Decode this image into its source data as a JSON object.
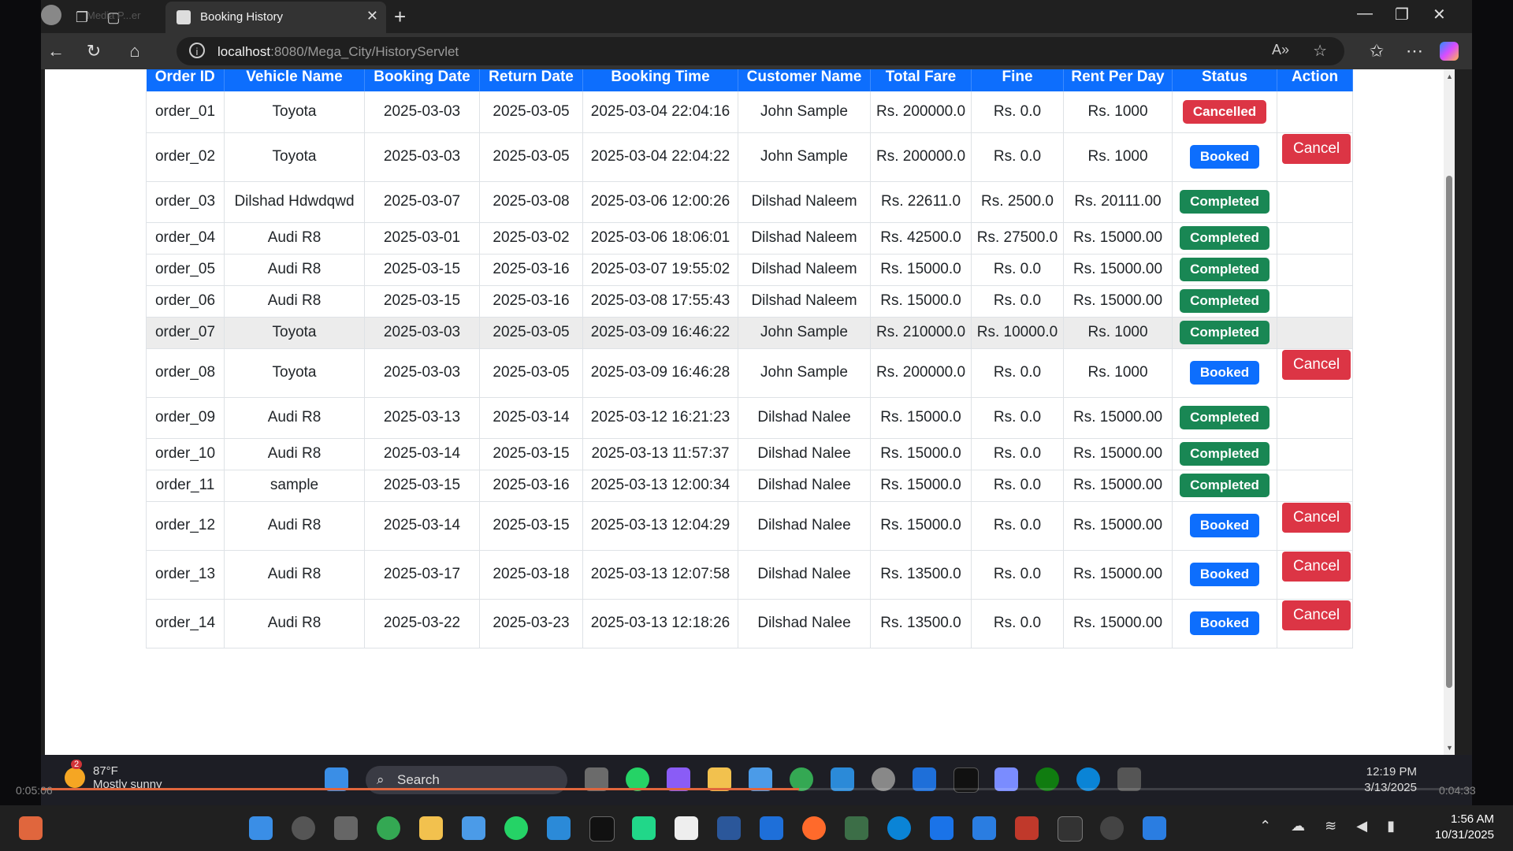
{
  "browser": {
    "tab_title": "Booking History",
    "ghost_tab": "Media P...er",
    "url_host": "localhost",
    "url_rest": ":8080/Mega_City/HistoryServlet"
  },
  "table": {
    "headers": [
      "Order ID",
      "Vehicle Name",
      "Booking Date",
      "Return Date",
      "Booking Time",
      "Customer Name",
      "Total Fare",
      "Fine",
      "Rent Per Day",
      "Status",
      "Action"
    ],
    "rows": [
      {
        "order": "order_01",
        "vehicle": "Toyota",
        "booking_date": "2025-03-03",
        "return_date": "2025-03-05",
        "booking_time": "2025-03-04 22:04:16",
        "customer": "John Sample",
        "fare": "Rs. 200000.0",
        "fine": "Rs. 0.0",
        "rent": "Rs. 1000",
        "status": "Cancelled",
        "action": ""
      },
      {
        "order": "order_02",
        "vehicle": "Toyota",
        "booking_date": "2025-03-03",
        "return_date": "2025-03-05",
        "booking_time": "2025-03-04 22:04:22",
        "customer": "John Sample",
        "fare": "Rs. 200000.0",
        "fine": "Rs. 0.0",
        "rent": "Rs. 1000",
        "status": "Booked",
        "action": "Cancel"
      },
      {
        "order": "order_03",
        "vehicle": "Dilshad Hdwdqwd",
        "booking_date": "2025-03-07",
        "return_date": "2025-03-08",
        "booking_time": "2025-03-06 12:00:26",
        "customer": "Dilshad Naleem",
        "fare": "Rs. 22611.0",
        "fine": "Rs. 2500.0",
        "rent": "Rs. 20111.00",
        "status": "Completed",
        "action": ""
      },
      {
        "order": "order_04",
        "vehicle": "Audi R8",
        "booking_date": "2025-03-01",
        "return_date": "2025-03-02",
        "booking_time": "2025-03-06 18:06:01",
        "customer": "Dilshad Naleem",
        "fare": "Rs. 42500.0",
        "fine": "Rs. 27500.0",
        "rent": "Rs. 15000.00",
        "status": "Completed",
        "action": ""
      },
      {
        "order": "order_05",
        "vehicle": "Audi R8",
        "booking_date": "2025-03-15",
        "return_date": "2025-03-16",
        "booking_time": "2025-03-07 19:55:02",
        "customer": "Dilshad Naleem",
        "fare": "Rs. 15000.0",
        "fine": "Rs. 0.0",
        "rent": "Rs. 15000.00",
        "status": "Completed",
        "action": ""
      },
      {
        "order": "order_06",
        "vehicle": "Audi R8",
        "booking_date": "2025-03-15",
        "return_date": "2025-03-16",
        "booking_time": "2025-03-08 17:55:43",
        "customer": "Dilshad Naleem",
        "fare": "Rs. 15000.0",
        "fine": "Rs. 0.0",
        "rent": "Rs. 15000.00",
        "status": "Completed",
        "action": ""
      },
      {
        "order": "order_07",
        "vehicle": "Toyota",
        "booking_date": "2025-03-03",
        "return_date": "2025-03-05",
        "booking_time": "2025-03-09 16:46:22",
        "customer": "John Sample",
        "fare": "Rs. 210000.0",
        "fine": "Rs. 10000.0",
        "rent": "Rs. 1000",
        "status": "Completed",
        "action": ""
      },
      {
        "order": "order_08",
        "vehicle": "Toyota",
        "booking_date": "2025-03-03",
        "return_date": "2025-03-05",
        "booking_time": "2025-03-09 16:46:28",
        "customer": "John Sample",
        "fare": "Rs. 200000.0",
        "fine": "Rs. 0.0",
        "rent": "Rs. 1000",
        "status": "Booked",
        "action": "Cancel"
      },
      {
        "order": "order_09",
        "vehicle": "Audi R8",
        "booking_date": "2025-03-13",
        "return_date": "2025-03-14",
        "booking_time": "2025-03-12 16:21:23",
        "customer": "Dilshad Nalee",
        "fare": "Rs. 15000.0",
        "fine": "Rs. 0.0",
        "rent": "Rs. 15000.00",
        "status": "Completed",
        "action": ""
      },
      {
        "order": "order_10",
        "vehicle": "Audi R8",
        "booking_date": "2025-03-14",
        "return_date": "2025-03-15",
        "booking_time": "2025-03-13 11:57:37",
        "customer": "Dilshad Nalee",
        "fare": "Rs. 15000.0",
        "fine": "Rs. 0.0",
        "rent": "Rs. 15000.00",
        "status": "Completed",
        "action": ""
      },
      {
        "order": "order_11",
        "vehicle": "sample",
        "booking_date": "2025-03-15",
        "return_date": "2025-03-16",
        "booking_time": "2025-03-13 12:00:34",
        "customer": "Dilshad Nalee",
        "fare": "Rs. 15000.0",
        "fine": "Rs. 0.0",
        "rent": "Rs. 15000.00",
        "status": "Completed",
        "action": ""
      },
      {
        "order": "order_12",
        "vehicle": "Audi R8",
        "booking_date": "2025-03-14",
        "return_date": "2025-03-15",
        "booking_time": "2025-03-13 12:04:29",
        "customer": "Dilshad Nalee",
        "fare": "Rs. 15000.0",
        "fine": "Rs. 0.0",
        "rent": "Rs. 15000.00",
        "status": "Booked",
        "action": "Cancel"
      },
      {
        "order": "order_13",
        "vehicle": "Audi R8",
        "booking_date": "2025-03-17",
        "return_date": "2025-03-18",
        "booking_time": "2025-03-13 12:07:58",
        "customer": "Dilshad Nalee",
        "fare": "Rs. 13500.0",
        "fine": "Rs. 0.0",
        "rent": "Rs. 15000.00",
        "status": "Booked",
        "action": "Cancel"
      },
      {
        "order": "order_14",
        "vehicle": "Audi R8",
        "booking_date": "2025-03-22",
        "return_date": "2025-03-23",
        "booking_time": "2025-03-13 12:18:26",
        "customer": "Dilshad Nalee",
        "fare": "Rs. 13500.0",
        "fine": "Rs. 0.0",
        "rent": "Rs. 15000.00",
        "status": "Booked",
        "action": "Cancel"
      }
    ]
  },
  "recorded_taskbar": {
    "weather_temp": "87°F",
    "weather_desc": "Mostly sunny",
    "weather_badge": "2",
    "search_placeholder": "Search",
    "time": "12:19 PM",
    "date": "3/13/2025"
  },
  "player": {
    "elapsed": "0:05:06",
    "remaining": "0:04:33",
    "progress": 0.53
  },
  "taskbar": {
    "time": "1:56 AM",
    "date": "10/31/2025"
  },
  "colors": {
    "header_blue": "#0d6efd",
    "booked": "#0d6efd",
    "completed": "#198754",
    "cancelled": "#dc3545"
  }
}
